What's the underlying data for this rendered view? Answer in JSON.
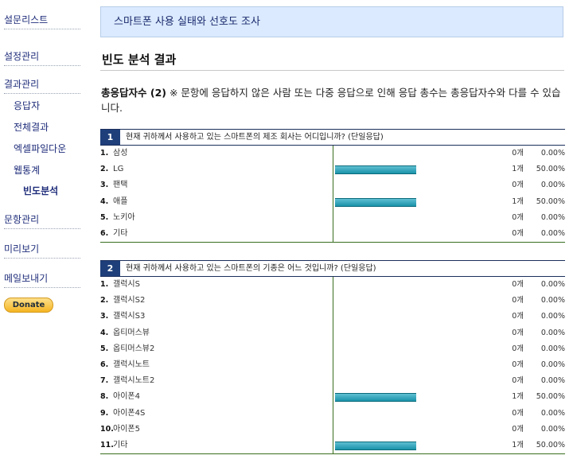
{
  "sidebar": {
    "survey_list": "설문리스트",
    "settings": "설정관리",
    "results": "결과관리",
    "respondents": "응답자",
    "all_results": "전체결과",
    "excel_download": "엑셀파일다운",
    "web_stats": "웹통계",
    "frequency_analysis": "빈도분석",
    "questions": "문항관리",
    "preview": "미리보기",
    "send_mail": "메일보내기",
    "donate": "Donate"
  },
  "banner": {
    "title": "스마트폰 사용 실태와 선호도 조사"
  },
  "section": {
    "title": "빈도 분석 결과"
  },
  "summary": {
    "label": "총응답자수 (2)",
    "note": " ※ 문항에 응답하지 않은 사람 또는 다중 응답으로 인해 응답 총수는 총응답자수와 다를 수 있습니다."
  },
  "questions": [
    {
      "number": "1",
      "text": "현재 귀하께서 사용하고 있는 스마트폰의 제조 회사는 어디입니까? (단일응답)",
      "options": [
        {
          "num": "1.",
          "label": "삼성",
          "count": "0개",
          "percent": "0.00%",
          "ratio": 0
        },
        {
          "num": "2.",
          "label": "LG",
          "count": "1개",
          "percent": "50.00%",
          "ratio": 0.5
        },
        {
          "num": "3.",
          "label": "팬택",
          "count": "0개",
          "percent": "0.00%",
          "ratio": 0
        },
        {
          "num": "4.",
          "label": "애플",
          "count": "1개",
          "percent": "50.00%",
          "ratio": 0.5
        },
        {
          "num": "5.",
          "label": "노키아",
          "count": "0개",
          "percent": "0.00%",
          "ratio": 0
        },
        {
          "num": "6.",
          "label": "기타",
          "count": "0개",
          "percent": "0.00%",
          "ratio": 0
        }
      ]
    },
    {
      "number": "2",
      "text": "현재 귀하께서 사용하고 있는 스마트폰의 기종은 어느 것입니까? (단일응답)",
      "options": [
        {
          "num": "1.",
          "label": "갤럭시S",
          "count": "0개",
          "percent": "0.00%",
          "ratio": 0
        },
        {
          "num": "2.",
          "label": "갤럭시S2",
          "count": "0개",
          "percent": "0.00%",
          "ratio": 0
        },
        {
          "num": "3.",
          "label": "갤럭시S3",
          "count": "0개",
          "percent": "0.00%",
          "ratio": 0
        },
        {
          "num": "4.",
          "label": "옵티머스뷰",
          "count": "0개",
          "percent": "0.00%",
          "ratio": 0
        },
        {
          "num": "5.",
          "label": "옵티머스뷰2",
          "count": "0개",
          "percent": "0.00%",
          "ratio": 0
        },
        {
          "num": "6.",
          "label": "갤럭시노트",
          "count": "0개",
          "percent": "0.00%",
          "ratio": 0
        },
        {
          "num": "7.",
          "label": "갤럭시노트2",
          "count": "0개",
          "percent": "0.00%",
          "ratio": 0
        },
        {
          "num": "8.",
          "label": "아이폰4",
          "count": "1개",
          "percent": "50.00%",
          "ratio": 0.5
        },
        {
          "num": "9.",
          "label": "아이폰4S",
          "count": "0개",
          "percent": "0.00%",
          "ratio": 0
        },
        {
          "num": "10.",
          "label": "아이폰5",
          "count": "0개",
          "percent": "0.00%",
          "ratio": 0
        },
        {
          "num": "11.",
          "label": "기타",
          "count": "1개",
          "percent": "50.00%",
          "ratio": 0.5
        }
      ]
    }
  ]
}
